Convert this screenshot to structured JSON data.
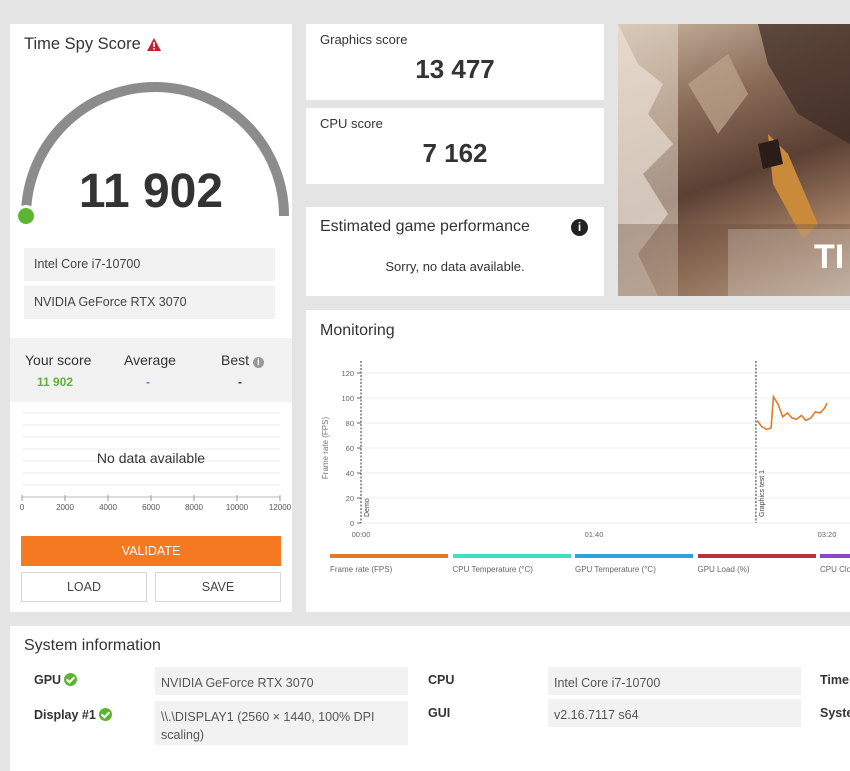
{
  "score_panel": {
    "title": "Time Spy Score",
    "score": "11 902",
    "cpu": "Intel Core i7-10700",
    "gpu": "NVIDIA GeForce RTX 3070",
    "gauge_fraction": 0.0
  },
  "comparison": {
    "your_score_label": "Your score",
    "your_score_value": "11 902",
    "average_label": "Average",
    "average_value": "-",
    "best_label": "Best",
    "best_value": "-",
    "no_data": "No data available",
    "axis_ticks": [
      "0",
      "2000",
      "4000",
      "6000",
      "8000",
      "10000",
      "12000"
    ]
  },
  "buttons": {
    "validate": "VALIDATE",
    "load": "LOAD",
    "save": "SAVE"
  },
  "graphics_score": {
    "label": "Graphics score",
    "value": "13 477"
  },
  "cpu_score": {
    "label": "CPU score",
    "value": "7 162"
  },
  "estimated": {
    "title": "Estimated game performance",
    "message": "Sorry, no data available."
  },
  "banner": {
    "text": "TI"
  },
  "monitoring": {
    "title": "Monitoring",
    "y_axis_label": "Frame rate (FPS)",
    "y_ticks": [
      "0",
      "20",
      "40",
      "60",
      "80",
      "100",
      "120"
    ],
    "x_ticks": [
      "00:00",
      "01:40",
      "03:20"
    ],
    "markers": [
      "Demo",
      "Graphics test 1"
    ],
    "legend": [
      {
        "label": "Frame rate (FPS)",
        "color": "#e07b28"
      },
      {
        "label": "CPU Temperature (°C)",
        "color": "#3fe0c2"
      },
      {
        "label": "GPU Temperature (°C)",
        "color": "#2f9fe0"
      },
      {
        "label": "GPU Load (%)",
        "color": "#b8333a"
      },
      {
        "label": "CPU Clo",
        "color": "#8a48c8"
      }
    ]
  },
  "chart_data": {
    "type": "line",
    "title": "",
    "xlabel": "",
    "ylabel": "Frame rate (FPS)",
    "ylim": [
      0,
      120
    ],
    "x_ticks": [
      "00:00",
      "01:40",
      "03:20"
    ],
    "series": [
      {
        "name": "Frame rate (FPS)",
        "x_seconds": [
          170,
          172,
          174,
          176,
          177,
          179,
          181,
          183,
          185,
          187,
          189,
          191,
          193,
          195,
          197,
          199,
          200
        ],
        "values": [
          82,
          77,
          75,
          76,
          101,
          95,
          85,
          88,
          84,
          83,
          86,
          82,
          84,
          89,
          88,
          92,
          96
        ]
      }
    ]
  },
  "system_info": {
    "title": "System information",
    "gpu_label": "GPU",
    "gpu_value": "NVIDIA GeForce RTX 3070",
    "display_label": "Display #1",
    "display_value": "\\\\.\\DISPLAY1 (2560 × 1440, 100% DPI scaling)",
    "cpu_label": "CPU",
    "cpu_value": "Intel Core i7-10700",
    "gui_label": "GUI",
    "gui_value": "v2.16.7117 s64",
    "time_label": "Time",
    "system_label": "Syste"
  },
  "colors": {
    "accent_orange": "#f47920",
    "score_green": "#5cb531",
    "gauge_gray": "#8c8c8c"
  }
}
